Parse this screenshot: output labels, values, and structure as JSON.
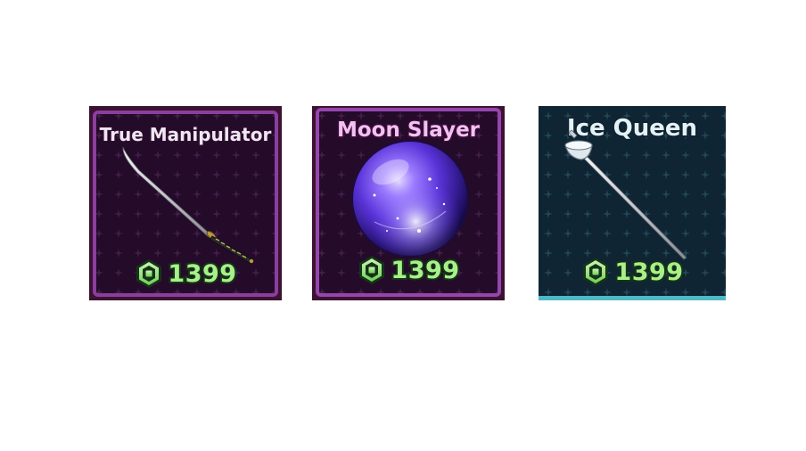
{
  "shop": {
    "items": [
      {
        "name": "True Manipulator",
        "price": "1399",
        "image": "katana-sword",
        "rarity_color": "#8a3fa0"
      },
      {
        "name": "Moon Slayer",
        "price": "1399",
        "image": "purple-galaxy-orb",
        "rarity_color": "#9546ad"
      },
      {
        "name": "Ice Queen",
        "price": "1399",
        "image": "ice-rapier",
        "rarity_color": "#4fb8c5"
      }
    ],
    "currency_icon": "robux-icon",
    "price_color": "#a8f08a"
  }
}
